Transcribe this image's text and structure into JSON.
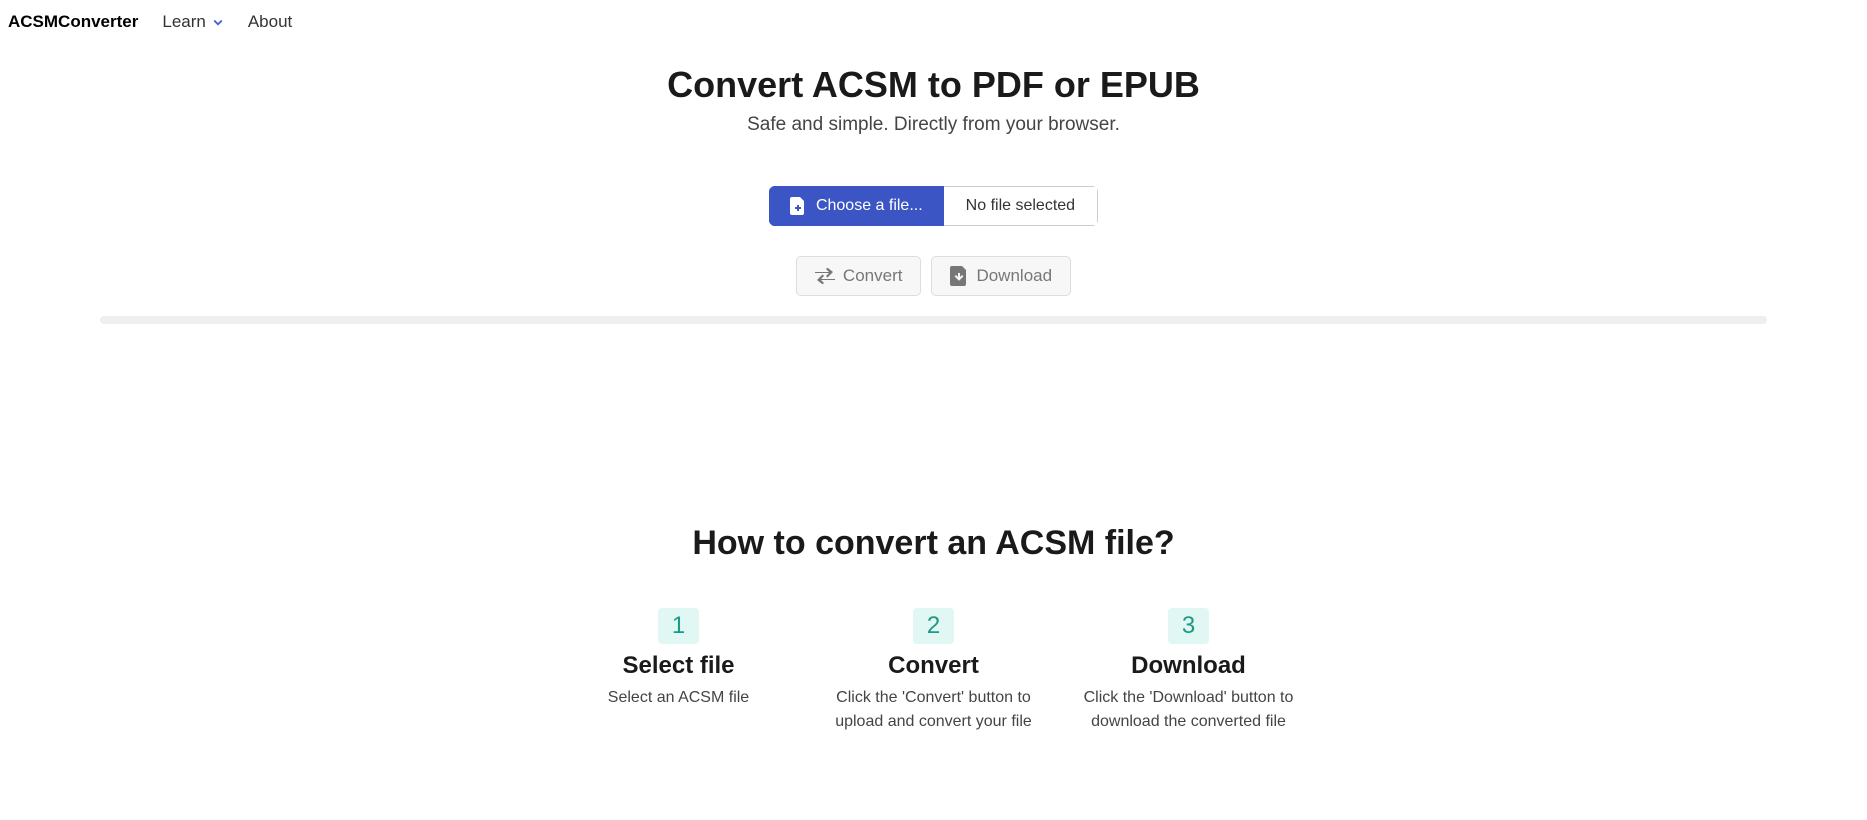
{
  "nav": {
    "brand": "ACSMConverter",
    "learn": "Learn",
    "about": "About"
  },
  "hero": {
    "title": "Convert ACSM to PDF or EPUB",
    "subtitle": "Safe and simple. Directly from your browser."
  },
  "file": {
    "choose_label": "Choose a file...",
    "status": "No file selected"
  },
  "actions": {
    "convert": "Convert",
    "download": "Download"
  },
  "howto": {
    "title": "How to convert an ACSM file?",
    "steps": [
      {
        "number": "1",
        "title": "Select file",
        "desc": "Select an ACSM file"
      },
      {
        "number": "2",
        "title": "Convert",
        "desc": "Click the 'Convert' button to upload and convert your file"
      },
      {
        "number": "3",
        "title": "Download",
        "desc": "Click the 'Download' button to download the converted file"
      }
    ]
  }
}
